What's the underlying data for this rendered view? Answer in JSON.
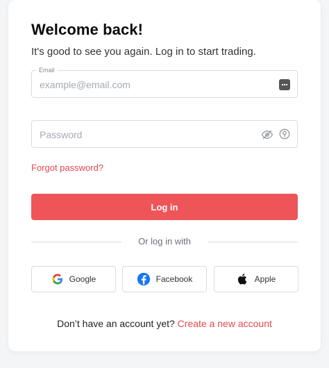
{
  "header": {
    "title": "Welcome back!",
    "subtitle": "It's good to see you again. Log in to start trading."
  },
  "email": {
    "label": "Email",
    "placeholder": "example@email.com",
    "value": ""
  },
  "password": {
    "placeholder": "Password",
    "value": ""
  },
  "links": {
    "forgot_password": "Forgot password?"
  },
  "buttons": {
    "login": "Log in"
  },
  "divider": {
    "text": "Or log in with"
  },
  "social": [
    {
      "label": "Google",
      "icon": "google-icon"
    },
    {
      "label": "Facebook",
      "icon": "facebook-icon"
    },
    {
      "label": "Apple",
      "icon": "apple-icon"
    }
  ],
  "footer": {
    "prompt": "Don’t have an account yet?",
    "create_link": "Create a new account"
  },
  "colors": {
    "accent": "#ee5558",
    "link": "#e5484d",
    "border": "#d9dbe0"
  }
}
